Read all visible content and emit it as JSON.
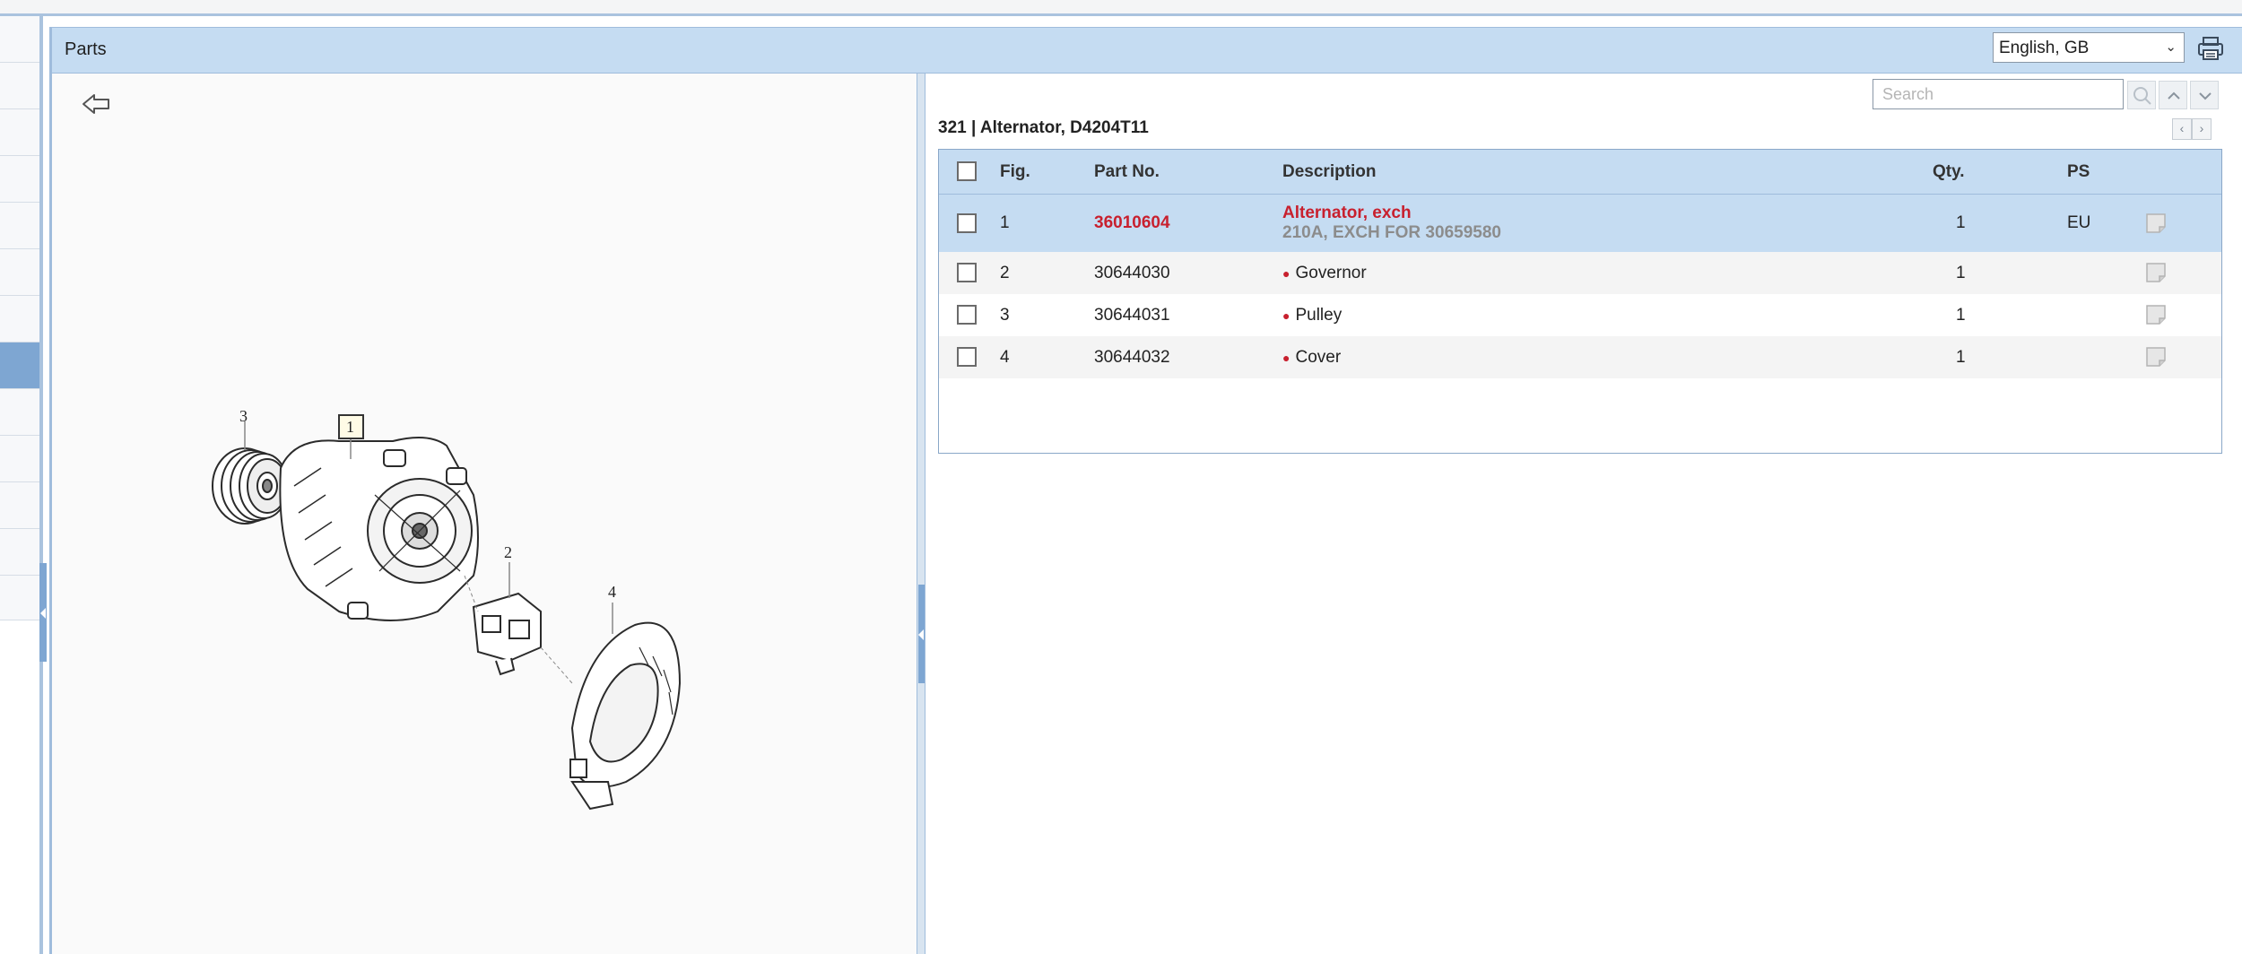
{
  "header": {
    "title": "Parts",
    "language": "English, GB"
  },
  "search": {
    "placeholder": "Search"
  },
  "section": {
    "title": "321  |  Alternator, D4204T11"
  },
  "table": {
    "columns": {
      "fig": "Fig.",
      "part_no": "Part No.",
      "description": "Description",
      "qty": "Qty.",
      "ps": "PS"
    },
    "rows": [
      {
        "fig": "1",
        "part_no": "36010604",
        "description": "Alternator, exch",
        "sub_description": "210A, EXCH FOR 30659580",
        "qty": "1",
        "ps": "EU"
      },
      {
        "fig": "2",
        "part_no": "30644030",
        "description": "Governor",
        "qty": "1",
        "ps": ""
      },
      {
        "fig": "3",
        "part_no": "30644031",
        "description": "Pulley",
        "qty": "1",
        "ps": ""
      },
      {
        "fig": "4",
        "part_no": "30644032",
        "description": "Cover",
        "qty": "1",
        "ps": ""
      }
    ]
  },
  "diagram": {
    "callouts": [
      "1",
      "2",
      "3",
      "4"
    ]
  },
  "icons": {
    "back": "back-arrow-icon",
    "print": "printer-icon",
    "search": "search-icon",
    "up": "chevron-up-icon",
    "down": "chevron-down-icon",
    "prev": "chevron-left-icon",
    "next": "chevron-right-icon",
    "note": "note-icon"
  },
  "colors": {
    "header_bg": "#c5dcf2",
    "accent": "#7ea6d2",
    "part_red": "#c8202e"
  }
}
